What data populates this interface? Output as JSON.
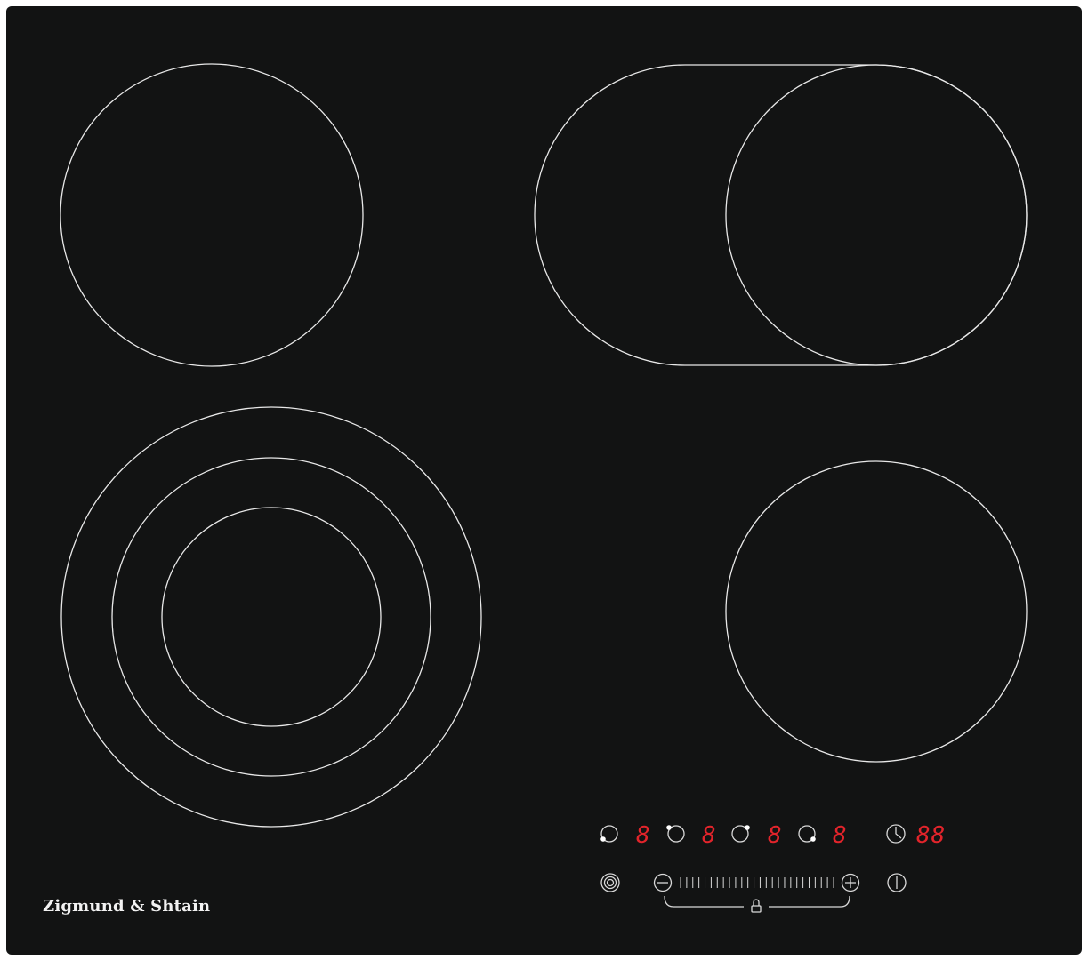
{
  "brand": {
    "name": "Zigmund & Shtain"
  },
  "colors": {
    "glass": "#121313",
    "zone_outline": "#e8e8e8",
    "display_red": "#e2242b",
    "icon": "#d9d9d9"
  },
  "cooking_zones": [
    {
      "name": "rear-left-zone",
      "type": "single"
    },
    {
      "name": "rear-right-zone",
      "type": "oval-dual"
    },
    {
      "name": "front-left-zone",
      "type": "triple-ring"
    },
    {
      "name": "front-right-zone",
      "type": "single"
    }
  ],
  "control_panel": {
    "zone_displays": [
      {
        "zone": "front-left",
        "value": "8"
      },
      {
        "zone": "rear-left",
        "value": "8"
      },
      {
        "zone": "rear-right",
        "value": "8"
      },
      {
        "zone": "front-right",
        "value": "8"
      }
    ],
    "timer_display": "88",
    "icons": {
      "zone_selectors": [
        "zone-select-icon",
        "zone-select-icon",
        "zone-select-icon",
        "zone-select-icon"
      ],
      "timer": "clock-icon",
      "minus": "minus-icon",
      "plus": "plus-icon",
      "power": "power-icon",
      "extra_zone": "dual-zone-icon",
      "lock": "lock-icon"
    },
    "slider_ticks": 26
  }
}
